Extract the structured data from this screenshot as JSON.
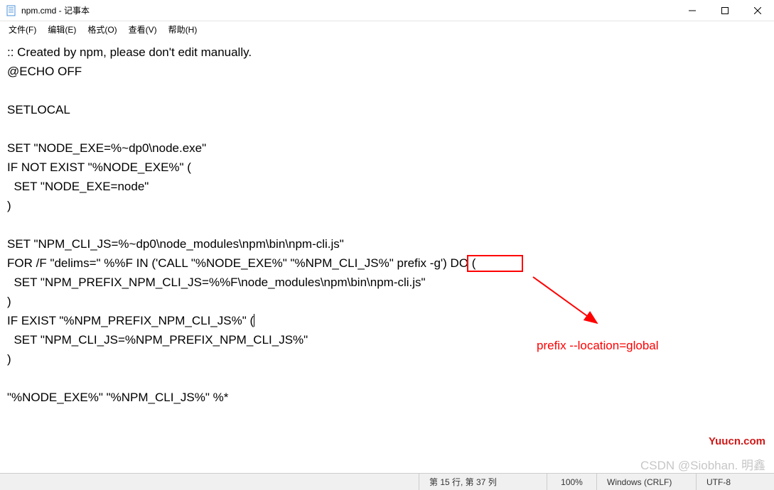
{
  "window": {
    "title": "npm.cmd - 记事本"
  },
  "menu": {
    "file": "文件(F)",
    "edit": "编辑(E)",
    "format": "格式(O)",
    "view": "查看(V)",
    "help": "帮助(H)"
  },
  "content": {
    "l1": ":: Created by npm, please don't edit manually.",
    "l2": "@ECHO OFF",
    "l3": "",
    "l4": "SETLOCAL",
    "l5": "",
    "l6": "SET \"NODE_EXE=%~dp0\\node.exe\"",
    "l7": "IF NOT EXIST \"%NODE_EXE%\" (",
    "l8": "  SET \"NODE_EXE=node\"",
    "l9": ")",
    "l10": "",
    "l11": "SET \"NPM_CLI_JS=%~dp0\\node_modules\\npm\\bin\\npm-cli.js\"",
    "l12_a": "FOR /F \"delims=\" %%F IN ('CALL \"%NODE_EXE%\" \"%NPM_CLI_JS%\" ",
    "l12_b": "prefix -g",
    "l12_c": "') DO (",
    "l13": "  SET \"NPM_PREFIX_NPM_CLI_JS=%%F\\node_modules\\npm\\bin\\npm-cli.js\"",
    "l14": ")",
    "l15_a": "IF EXIST \"%NPM_PREFIX_NPM_CLI_JS%\" (",
    "l16": "  SET \"NPM_CLI_JS=%NPM_PREFIX_NPM_CLI_JS%\"",
    "l17": ")",
    "l18": "",
    "l19": "\"%NODE_EXE%\" \"%NPM_CLI_JS%\" %*"
  },
  "annotation": {
    "text": "prefix --location=global"
  },
  "watermarks": {
    "w1": "Yuucn.com",
    "w2": "CSDN @Siobhan. 明鑫"
  },
  "status": {
    "position": "第 15 行, 第 37 列",
    "zoom": "100%",
    "encoding": "Windows (CRLF)",
    "charset": "UTF-8"
  }
}
